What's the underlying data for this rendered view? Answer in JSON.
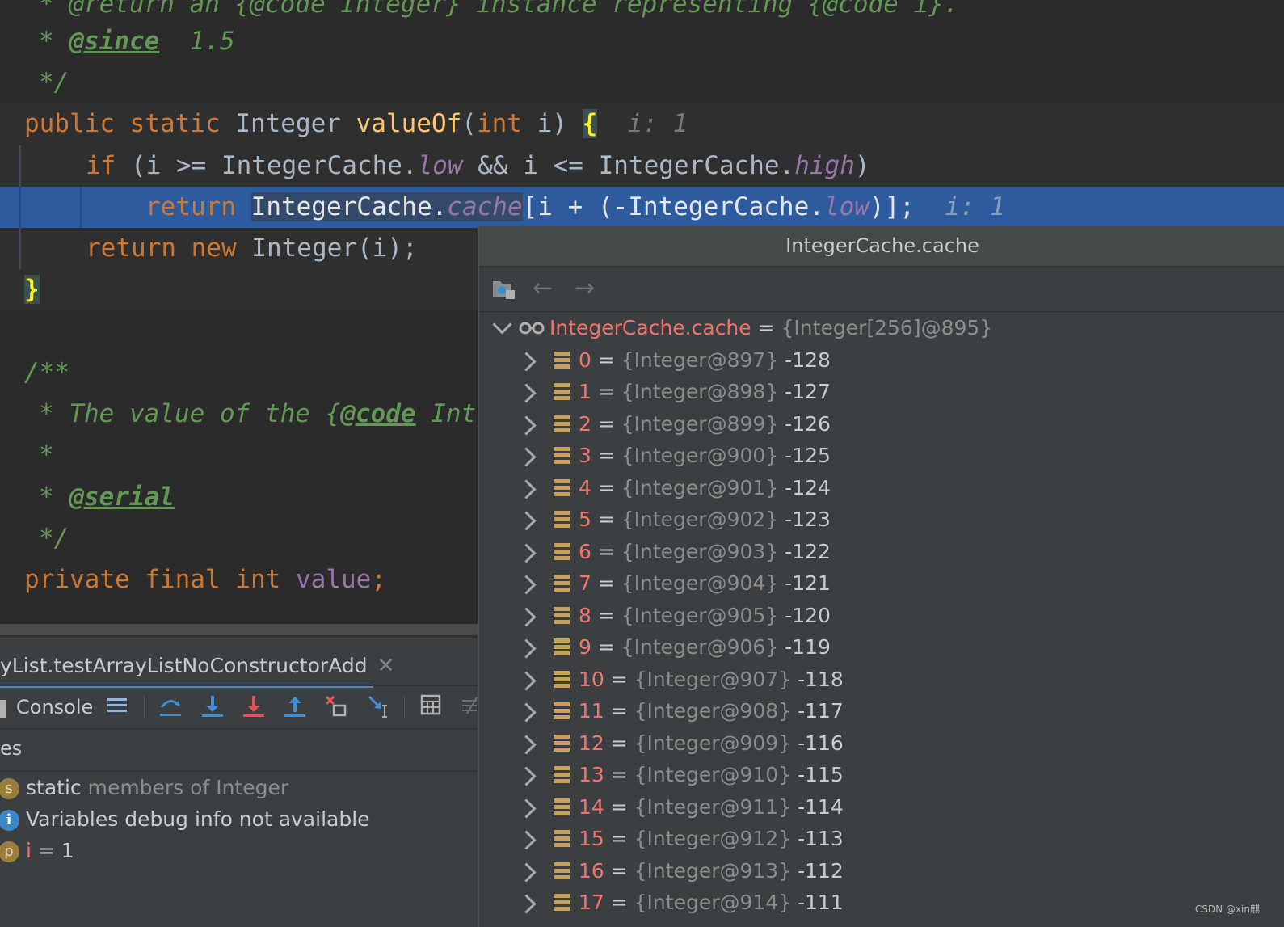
{
  "editor": {
    "lines": {
      "l0": "* @return an {@code Integer} instance representing {@code i}.",
      "since_star": "* ",
      "since_tag": "@since",
      "since_val": "  1.5",
      "close1": "*/",
      "sig_public": "public",
      "sig_static": "static",
      "sig_type": "Integer",
      "sig_name": "valueOf",
      "sig_int": "int",
      "sig_param": "i) ",
      "sig_open": "(",
      "sig_brace": "{",
      "sig_hint": "i: 1",
      "if_kw": "if",
      "if_a": " (i >= IntegerCache.",
      "if_low": "low",
      "if_b": " && i <= IntegerCache.",
      "if_high": "high",
      "if_c": ")",
      "ret_kw": "return",
      "ret_a": "IntegerCache.",
      "ret_cache": "cache",
      "ret_b": "[i + (-IntegerCache.",
      "ret_low": "low",
      "ret_c": ")];",
      "ret_hint": "i: 1",
      "ret2_kw": "return new",
      "ret2_rest": " Integer(i);",
      "end_brace": "}",
      "doc_open": "/**",
      "doc_line": "* The value of the {",
      "doc_code": "@code",
      "doc_int": " Int",
      "doc_star": "*",
      "serial_star": "* ",
      "serial_tag": "@serial",
      "close2": "*/",
      "priv_kw": "private final int",
      "priv_field": "value",
      "priv_semi": ";"
    }
  },
  "debug": {
    "session_tab": "yList.testArrayListNoConstructorAdd",
    "console_label": "Console",
    "frames_label": "es",
    "variables": [
      {
        "badge": "s",
        "name": "static",
        "rest": " members of Integer"
      },
      {
        "badge": "i",
        "name": "Variables debug info not available",
        "rest": ""
      },
      {
        "badge": "p",
        "name": "i",
        "rest": " = 1"
      }
    ]
  },
  "popup": {
    "title": "IntegerCache.cache",
    "root": {
      "name": "IntegerCache.cache",
      "eq": " = ",
      "type": "{Integer[256]@895}"
    },
    "items": [
      {
        "idx": "0",
        "type": "{Integer@897}",
        "val": "-128"
      },
      {
        "idx": "1",
        "type": "{Integer@898}",
        "val": "-127"
      },
      {
        "idx": "2",
        "type": "{Integer@899}",
        "val": "-126"
      },
      {
        "idx": "3",
        "type": "{Integer@900}",
        "val": "-125"
      },
      {
        "idx": "4",
        "type": "{Integer@901}",
        "val": "-124"
      },
      {
        "idx": "5",
        "type": "{Integer@902}",
        "val": "-123"
      },
      {
        "idx": "6",
        "type": "{Integer@903}",
        "val": "-122"
      },
      {
        "idx": "7",
        "type": "{Integer@904}",
        "val": "-121"
      },
      {
        "idx": "8",
        "type": "{Integer@905}",
        "val": "-120"
      },
      {
        "idx": "9",
        "type": "{Integer@906}",
        "val": "-119"
      },
      {
        "idx": "10",
        "type": "{Integer@907}",
        "val": "-118"
      },
      {
        "idx": "11",
        "type": "{Integer@908}",
        "val": "-117"
      },
      {
        "idx": "12",
        "type": "{Integer@909}",
        "val": "-116"
      },
      {
        "idx": "13",
        "type": "{Integer@910}",
        "val": "-115"
      },
      {
        "idx": "14",
        "type": "{Integer@911}",
        "val": "-114"
      },
      {
        "idx": "15",
        "type": "{Integer@912}",
        "val": "-113"
      },
      {
        "idx": "16",
        "type": "{Integer@913}",
        "val": "-112"
      },
      {
        "idx": "17",
        "type": "{Integer@914}",
        "val": "-111"
      }
    ]
  },
  "watermark": "CSDN @xin麒",
  "colors": {
    "exec_line": "#2d5b9e",
    "keyword": "#cc7832",
    "comment": "#629755",
    "field": "#9876aa",
    "index": "#f0736e"
  }
}
